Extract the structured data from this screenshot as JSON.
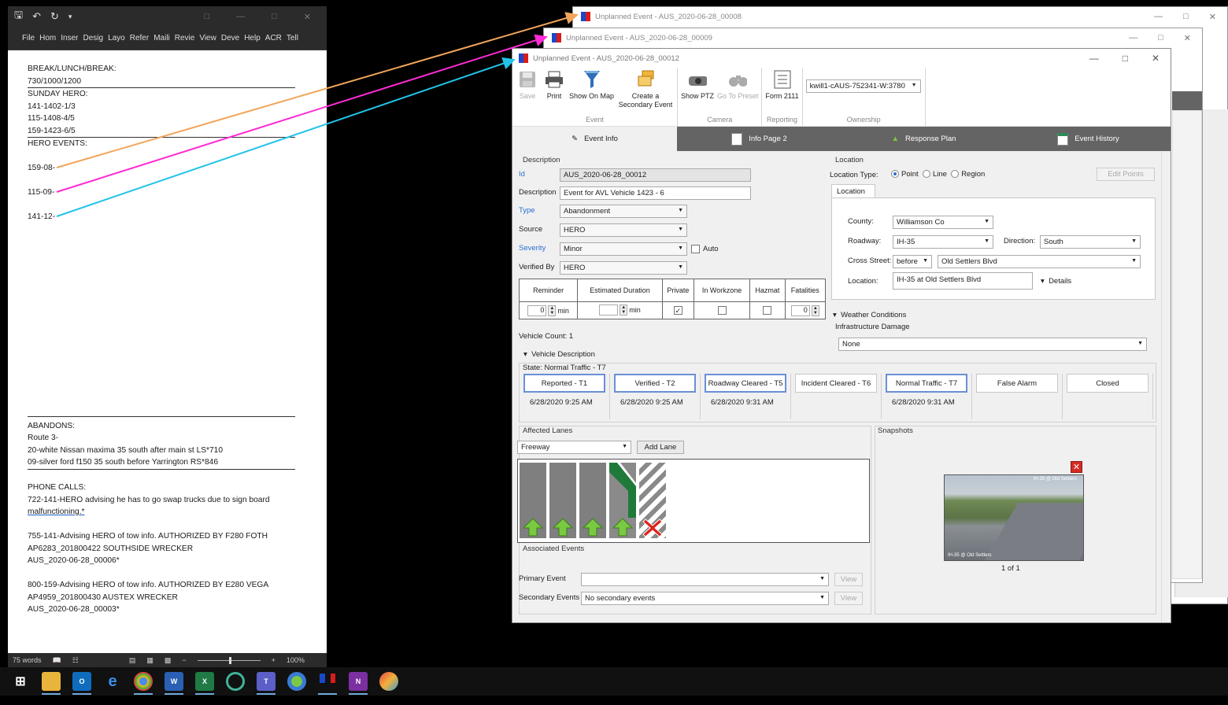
{
  "word": {
    "title_icons": [
      "save-icon",
      "undo-icon",
      "redo-icon"
    ],
    "ribbon_tabs": [
      "File",
      "Hom",
      "Inser",
      "Desig",
      "Layo",
      "Refer",
      "Maili",
      "Revie",
      "View",
      "Deve",
      "Help",
      "ACR",
      "Tell"
    ],
    "doc_lines": [
      {
        "text": "BREAK/LUNCH/BREAK:"
      },
      {
        "text": "730/1000/1200",
        "rule": true
      },
      {
        "text": "SUNDAY HERO:"
      },
      {
        "text": "141-1402-1/3"
      },
      {
        "text": "115-1408-4/5"
      },
      {
        "text": "159-1423-6/5",
        "rule": true
      },
      {
        "text": "HERO EVENTS:"
      },
      {
        "text": ""
      },
      {
        "text": "159-08-"
      },
      {
        "text": ""
      },
      {
        "text": "115-09-"
      },
      {
        "text": ""
      },
      {
        "text": "141-12-"
      }
    ],
    "doc_lines_bottom": [
      {
        "text": "ABANDONS:"
      },
      {
        "text": "Route 3-"
      },
      {
        "text": "20-white Nissan maxima 35 south after main st LS*710"
      },
      {
        "text": "09-silver ford f150 35 south before Yarrington RS*846",
        "rule": true
      },
      {
        "text": ""
      },
      {
        "text": "PHONE CALLS:"
      },
      {
        "text": "722-141-HERO advising he has to go swap trucks due to sign board"
      },
      {
        "text": "malfunctioning.*",
        "underline": true
      },
      {
        "text": ""
      },
      {
        "text": "755-141-Advising HERO of tow info. AUTHORIZED BY F280 FOTH"
      },
      {
        "text": "AP6283_201800422  SOUTHSIDE WRECKER"
      },
      {
        "text": "AUS_2020-06-28_00006*"
      },
      {
        "text": ""
      },
      {
        "text": "800-159-Advising HERO of tow info. AUTHORIZED BY E280 VEGA"
      },
      {
        "text": "AP4959_201800430    AUSTEX WRECKER"
      },
      {
        "text": "AUS_2020-06-28_00003*"
      }
    ],
    "status_words": "75 words",
    "zoom": "100%"
  },
  "bg_windows": [
    {
      "title": "Unplanned Event - AUS_2020-06-28_00008"
    },
    {
      "title": "Unplanned Event - AUS_2020-06-28_00009"
    }
  ],
  "event": {
    "window_title": "Unplanned Event - AUS_2020-06-28_00012",
    "toolbar": {
      "save": "Save",
      "print": "Print",
      "show_on_map": "Show On Map",
      "create_secondary": "Create a Secondary Event",
      "group_event": "Event",
      "show_ptz": "Show PTZ",
      "go_to_preset": "Go To Preset",
      "group_camera": "Camera",
      "form_2111": "Form 2111",
      "group_reporting": "Reporting",
      "ownership_value": "kwill1-cAUS-752341-W:3780",
      "group_ownership": "Ownership"
    },
    "tabs": [
      "Event Info",
      "Info Page 2",
      "Response Plan",
      "Event History"
    ],
    "description": {
      "section": "Description",
      "id_label": "Id",
      "id_value": "AUS_2020-06-28_00012",
      "desc_label": "Description",
      "desc_value": "Event for AVL Vehicle 1423 - 6",
      "type_label": "Type",
      "type_value": "Abandonment",
      "source_label": "Source",
      "source_value": "HERO",
      "severity_label": "Severity",
      "severity_value": "Minor",
      "auto_label": "Auto",
      "verified_label": "Verified By",
      "verified_value": "HERO"
    },
    "grid": {
      "headers": [
        "Reminder",
        "Estimated Duration",
        "Private",
        "In Workzone",
        "Hazmat",
        "Fatalities"
      ],
      "reminder_value": "0",
      "min": "min",
      "fatalities_value": "0",
      "private_checked": true
    },
    "vehicle_count": "Vehicle Count: 1",
    "vehicle_description": "Vehicle Description",
    "location": {
      "section": "Location",
      "type_label": "Location Type:",
      "point": "Point",
      "line": "Line",
      "region": "Region",
      "edit_points": "Edit Points",
      "subtab": "Location",
      "county_label": "County:",
      "county_value": "Williamson Co",
      "roadway_label": "Roadway:",
      "roadway_value": "IH-35",
      "direction_label": "Direction:",
      "direction_value": "South",
      "cross_label": "Cross Street:",
      "cross_rel": "before",
      "cross_value": "Old Settlers Blvd",
      "location_label": "Location:",
      "location_value": "IH-35 at Old Settlers Blvd",
      "details": "Details"
    },
    "weather": "Weather Conditions",
    "infra_label": "Infrastructure Damage",
    "infra_value": "None",
    "state": {
      "label": "State: Normal Traffic - T7",
      "buttons": [
        {
          "label": "Reported - T1",
          "time": "6/28/2020 9:25 AM",
          "selected": true
        },
        {
          "label": "Verified - T2",
          "time": "6/28/2020 9:25 AM",
          "selected": true
        },
        {
          "label": "Roadway Cleared - T5",
          "time": "6/28/2020 9:31 AM",
          "selected": true
        },
        {
          "label": "Incident Cleared - T6",
          "time": "",
          "selected": false
        },
        {
          "label": "Normal Traffic - T7",
          "time": "6/28/2020 9:31 AM",
          "selected": true
        },
        {
          "label": "False Alarm",
          "time": "",
          "selected": false
        },
        {
          "label": "Closed",
          "time": "",
          "selected": false
        }
      ]
    },
    "lanes": {
      "section": "Affected Lanes",
      "type_value": "Freeway",
      "add_lane": "Add Lane",
      "items": [
        "lane-open",
        "lane-open",
        "lane-open",
        "shoulder-open",
        "shoulder-blocked"
      ]
    },
    "snapshots": {
      "section": "Snapshots",
      "counter": "1  of  1",
      "cam_caption": "IH-35 @ Old Settlers"
    },
    "associated": {
      "section": "Associated Events",
      "primary_label": "Primary Event",
      "primary_value": "",
      "secondary_label": "Secondary Events",
      "secondary_value": "No secondary events",
      "view": "View"
    }
  },
  "colors": {
    "arrow_orange": "#f2a55a",
    "arrow_magenta": "#ff2bd6",
    "arrow_cyan": "#22c3e8",
    "green_arrow": "#7ac943",
    "blocked_red": "#e0201b",
    "selected_border": "#6b8fd6"
  },
  "taskbar": [
    "windows-icon",
    "file-explorer-icon",
    "outlook-icon",
    "edge-icon",
    "chrome-icon",
    "word-icon",
    "excel-icon",
    "app-circle-icon",
    "teams-icon",
    "maps-icon",
    "flag-app-icon",
    "onenote-icon",
    "paint-icon"
  ]
}
